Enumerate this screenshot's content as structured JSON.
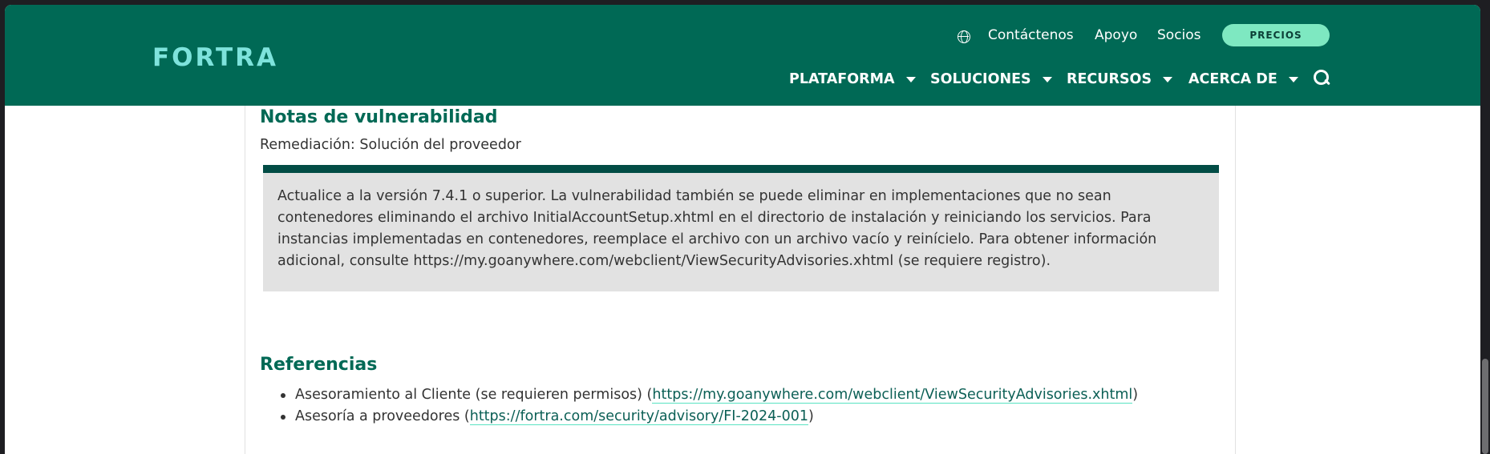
{
  "header": {
    "logo": "FORTRA",
    "utility": {
      "contact": "Contáctenos",
      "support": "Apoyo",
      "partners": "Socios",
      "pricing": "PRECIOS"
    },
    "nav": [
      {
        "label": "PLATAFORMA"
      },
      {
        "label": "SOLUCIONES"
      },
      {
        "label": "RECURSOS"
      },
      {
        "label": "ACERCA DE"
      }
    ]
  },
  "content": {
    "notes_heading": "Notas de vulnerabilidad",
    "remediation": "Remediación: Solución del proveedor",
    "notice_text": "Actualice a la versión 7.4.1 o superior. La vulnerabilidad también se puede eliminar en implementaciones que no sean contenedores eliminando el archivo InitialAccountSetup.xhtml en el directorio de instalación y reiniciando los servicios. Para instancias implementadas en contenedores, reemplace el archivo con un archivo vacío y reinícielo. Para obtener información adicional, consulte https://my.goanywhere.com/webclient/ViewSecurityAdvisories.xhtml (se requiere registro).",
    "references_heading": "Referencias",
    "references": [
      {
        "prefix": "Asesoramiento al Cliente (se requieren permisos) (",
        "link": "https://my.goanywhere.com/webclient/ViewSecurityAdvisories.xhtml",
        "suffix": ")"
      },
      {
        "prefix": "Asesoría a proveedores (",
        "link": "https://fortra.com/security/advisory/FI-2024-001",
        "suffix": ")"
      }
    ]
  },
  "colors": {
    "brand": "#006955",
    "accent": "#7ee8c1",
    "notice_bar": "#024c45"
  }
}
